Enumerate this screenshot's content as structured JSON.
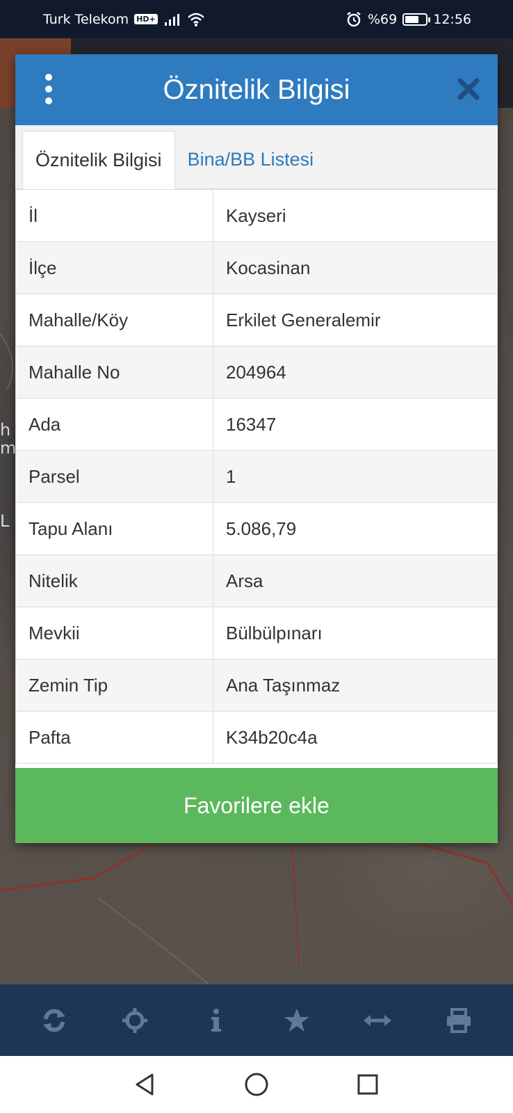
{
  "status_bar": {
    "carrier": "Turk Telekom",
    "network_badge": "HD+",
    "battery_text": "%69",
    "battery_level": 0.69,
    "time": "12:56"
  },
  "map": {
    "side_text_1": "h",
    "side_text_2": "m",
    "side_text_3": "L"
  },
  "dialog": {
    "title": "Öznitelik Bilgisi",
    "tabs": [
      {
        "label": "Öznitelik Bilgisi",
        "active": true
      },
      {
        "label": "Bina/BB Listesi",
        "active": false
      }
    ],
    "rows": [
      {
        "label": "İl",
        "value": "Kayseri"
      },
      {
        "label": "İlçe",
        "value": "Kocasinan"
      },
      {
        "label": "Mahalle/Köy",
        "value": "Erkilet Generalemir"
      },
      {
        "label": "Mahalle No",
        "value": "204964"
      },
      {
        "label": "Ada",
        "value": "16347"
      },
      {
        "label": "Parsel",
        "value": "1"
      },
      {
        "label": "Tapu Alanı",
        "value": "5.086,79"
      },
      {
        "label": "Nitelik",
        "value": "Arsa"
      },
      {
        "label": "Mevkii",
        "value": "Bülbülpınarı"
      },
      {
        "label": "Zemin Tip",
        "value": "Ana Taşınmaz"
      },
      {
        "label": "Pafta",
        "value": "K34b20c4a"
      }
    ],
    "favorite_button_label": "Favorilere ekle"
  },
  "toolbar": {
    "icons": [
      "refresh-icon",
      "crosshair-icon",
      "info-icon",
      "star-icon",
      "measure-icon",
      "print-icon"
    ],
    "icon_color": "#5f7a99"
  },
  "colors": {
    "header_blue": "#2e7bbf",
    "button_green": "#5cb85c",
    "toolbar_navy": "#1e3654",
    "status_navy": "#101a2c"
  }
}
